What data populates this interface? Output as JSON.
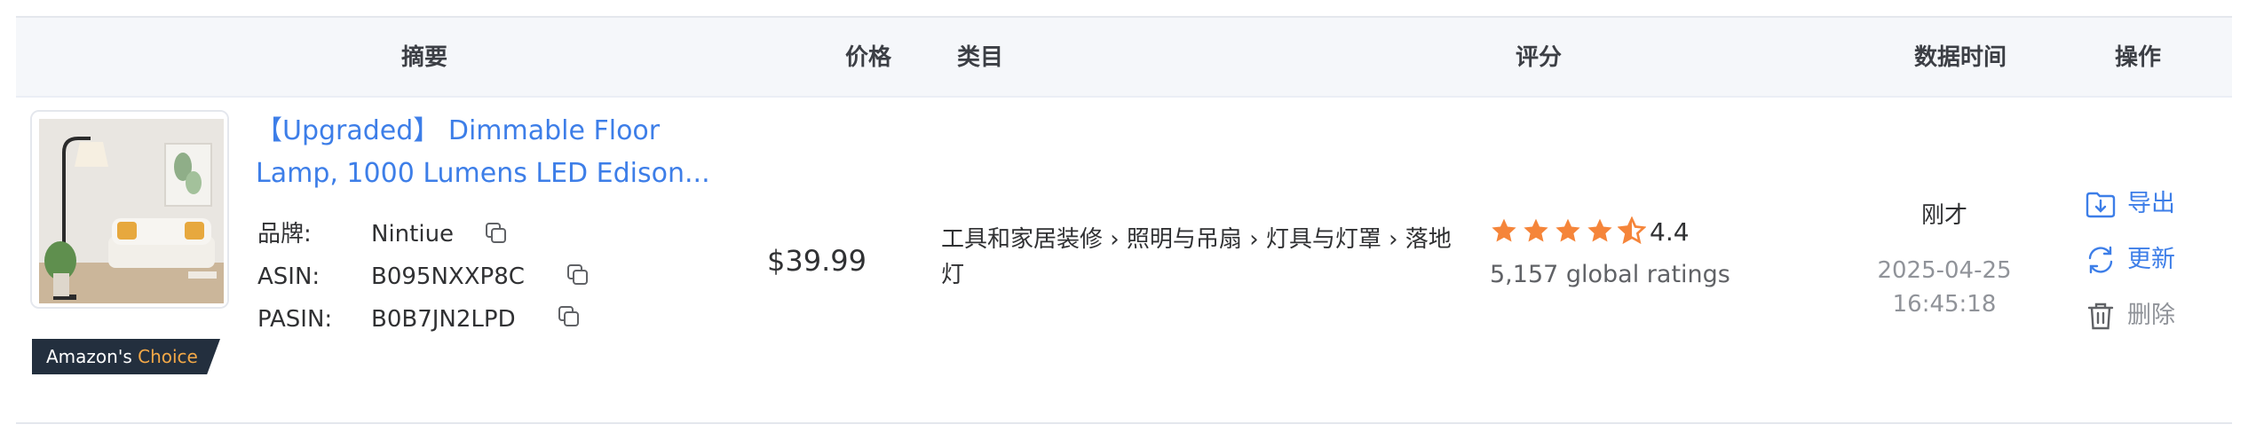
{
  "table": {
    "headers": {
      "summary": "摘要",
      "price": "价格",
      "category": "类目",
      "rating": "评分",
      "data_time": "数据时间",
      "actions": "操作"
    }
  },
  "product": {
    "title_line1": "【Upgraded】 Dimmable Floor",
    "title_line2": "Lamp, 1000 Lumens LED Edison...",
    "badge": {
      "prefix": "Amazon's",
      "highlight": "Choice"
    },
    "brand_label": "品牌:",
    "brand": "Nintiue",
    "asin_label": "ASIN:",
    "asin": "B095NXXP8C",
    "pasin_label": "PASIN:",
    "pasin": "B0B7JN2LPD",
    "price": "$39.99",
    "category_line1": "工具和家居装修 › 照明与吊扇 › 灯具与灯罩 › 落地",
    "category_line2": "灯",
    "rating": {
      "stars": 4.5,
      "value": "4.4",
      "count": "5,157 global ratings"
    },
    "time_relative": "刚才",
    "time_date": "2025-04-25",
    "time_clock": "16:45:18"
  },
  "actions": {
    "export": "导出",
    "update": "更新",
    "delete": "删除"
  },
  "colors": {
    "link": "#3d7ee8",
    "star": "#f5853a",
    "header_bg": "#f5f7fa",
    "muted": "#909399",
    "badge_bg": "#232f3e",
    "badge_accent": "#f3a847"
  },
  "icons": {
    "copy": "copy-icon",
    "export": "folder-download-icon",
    "update": "refresh-icon",
    "delete": "trash-icon",
    "star": "star-icon"
  }
}
